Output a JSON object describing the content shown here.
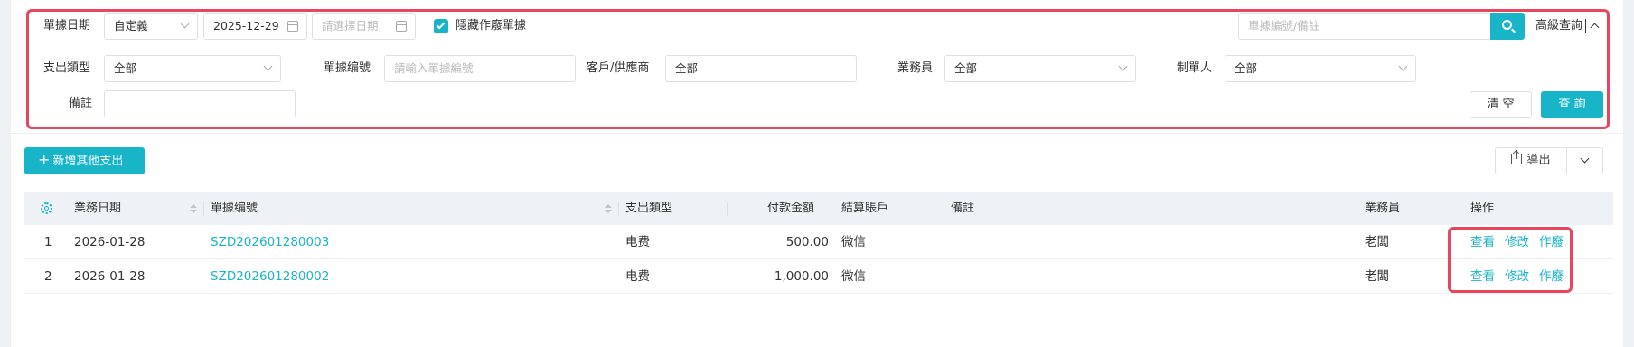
{
  "filters": {
    "doc_date_label": "單據日期",
    "date_mode_value": "自定義",
    "date_start_value": "2025-12-29",
    "date_end_placeholder": "請選擇日期",
    "hide_void_label": "隱藏作廢單據",
    "hide_void_checked": true,
    "search_placeholder": "單據編號/備註",
    "advanced_label": "高級查詢",
    "expense_type_label": "支出類型",
    "expense_type_value": "全部",
    "doc_no_label": "單據编號",
    "doc_no_placeholder": "請輸入單據編號",
    "customer_label": "客戶/供應商",
    "customer_value": "全部",
    "salesman_label": "業務員",
    "salesman_value": "全部",
    "creator_label": "制單人",
    "creator_value": "全部",
    "remark_label": "備註",
    "remark_value": "",
    "clear_label": "清 空",
    "query_label": "查 詢"
  },
  "toolbar": {
    "add_label": "新增其他支出",
    "export_label": "導出"
  },
  "table": {
    "columns": {
      "date": "業務日期",
      "doc_no": "單據编號",
      "type": "支出類型",
      "amount": "付款金額",
      "account": "結算賬戶",
      "remark": "備註",
      "salesman": "業務員",
      "ops": "操作"
    },
    "rows": [
      {
        "idx": "1",
        "date": "2026-01-28",
        "doc_no": "SZD202601280003",
        "type": "电费",
        "amount": "500.00",
        "account": "微信",
        "remark": "",
        "salesman": "老闆",
        "view": "查看",
        "edit": "修改",
        "void": "作廢"
      },
      {
        "idx": "2",
        "date": "2026-01-28",
        "doc_no": "SZD202601280002",
        "type": "电费",
        "amount": "1,000.00",
        "account": "微信",
        "remark": "",
        "salesman": "老闆",
        "view": "查看",
        "edit": "修改",
        "void": "作廢"
      }
    ]
  },
  "colors": {
    "accent": "#18b4c8",
    "highlight": "#e8455f"
  }
}
